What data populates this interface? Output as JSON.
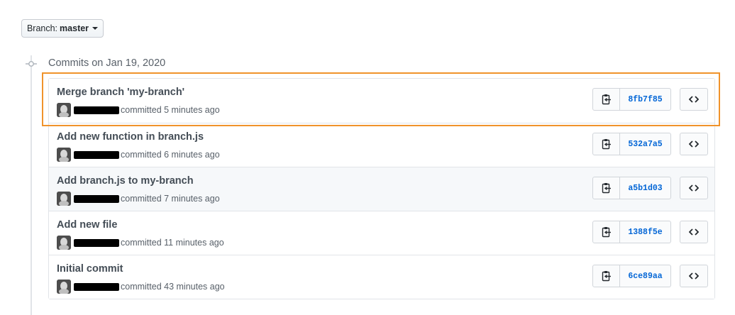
{
  "branch": {
    "prefix": "Branch:",
    "name": "master"
  },
  "timeline": {
    "group_title": "Commits on Jan 19, 2020"
  },
  "commits": [
    {
      "title": "Merge branch 'my-branch'",
      "meta": "committed 5 minutes ago",
      "sha": "8fb7f85"
    },
    {
      "title": "Add new function in branch.js",
      "meta": "committed 6 minutes ago",
      "sha": "532a7a5"
    },
    {
      "title": "Add branch.js to my-branch",
      "meta": "committed 7 minutes ago",
      "sha": "a5b1d03"
    },
    {
      "title": "Add new file",
      "meta": "committed 11 minutes ago",
      "sha": "1388f5e"
    },
    {
      "title": "Initial commit",
      "meta": "committed 43 minutes ago",
      "sha": "6ce89aa"
    }
  ],
  "icons": {
    "copy": "clipboard-icon",
    "browse": "code-icon",
    "node": "git-commit-icon",
    "caret": "caret-down-icon"
  },
  "colors": {
    "highlight": "#f0932b",
    "sha_link": "#0366d6",
    "alt_row": "#f6f8fa"
  }
}
